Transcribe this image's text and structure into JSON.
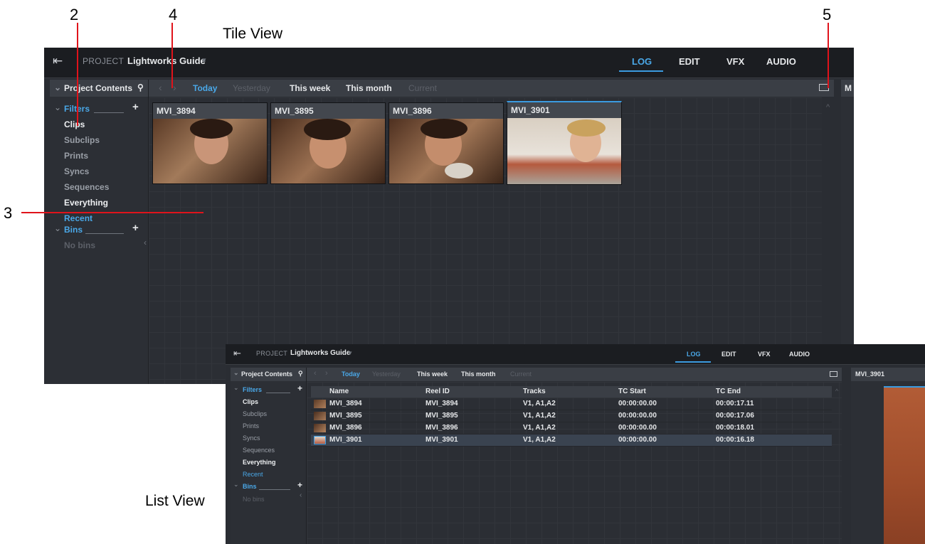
{
  "captions": {
    "tile_view": "Tile View",
    "list_view": "List View",
    "callout_2": "2",
    "callout_3": "3",
    "callout_4": "4",
    "callout_5": "5"
  },
  "app": {
    "project_label": "PROJECT",
    "project_name": "Lightworks Guide",
    "caret": "▾",
    "exit_icon": "⇤",
    "tabs": [
      "LOG",
      "EDIT",
      "VFX",
      "AUDIO"
    ],
    "active_tab": "LOG",
    "accent": "#3b9be0"
  },
  "sidebar": {
    "header": "Project Contents",
    "filters_label": "Filters",
    "bins_label": "Bins",
    "filters": [
      "Clips",
      "Subclips",
      "Prints",
      "Syncs",
      "Sequences",
      "Everything",
      "Recent"
    ],
    "no_bins": "No bins"
  },
  "toolbar": {
    "items": [
      "Today",
      "Yesterday",
      "This week",
      "This month",
      "Current"
    ]
  },
  "tiles": [
    "MVI_3894",
    "MVI_3895",
    "MVI_3896",
    "MVI_3901"
  ],
  "tile_panel_cut": "M",
  "list": {
    "columns": [
      "Name",
      "Reel ID",
      "Tracks",
      "TC Start",
      "TC End"
    ],
    "rows": [
      {
        "name": "MVI_3894",
        "reel": "MVI_3894",
        "tracks": "V1, A1,A2",
        "tc_start": "00:00:00.00",
        "tc_end": "00:00:17.11"
      },
      {
        "name": "MVI_3895",
        "reel": "MVI_3895",
        "tracks": "V1, A1,A2",
        "tc_start": "00:00:00.00",
        "tc_end": "00:00:17.06"
      },
      {
        "name": "MVI_3896",
        "reel": "MVI_3896",
        "tracks": "V1, A1,A2",
        "tc_start": "00:00:00.00",
        "tc_end": "00:00:18.01"
      },
      {
        "name": "MVI_3901",
        "reel": "MVI_3901",
        "tracks": "V1, A1,A2",
        "tc_start": "00:00:00.00",
        "tc_end": "00:00:16.18"
      }
    ],
    "viewer_title": "MVI_3901"
  }
}
